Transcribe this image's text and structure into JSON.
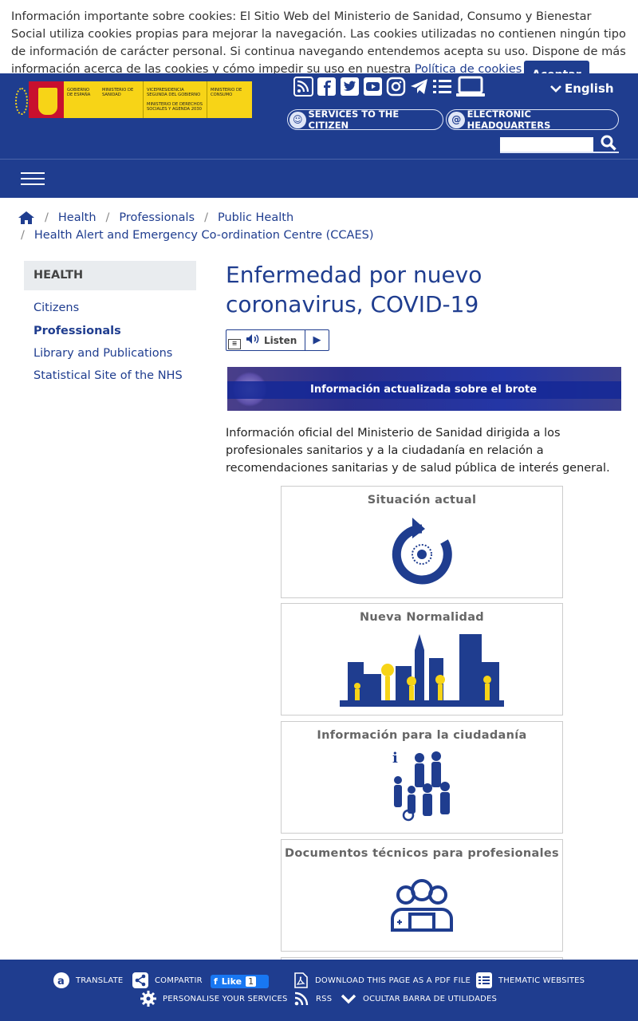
{
  "cookie": {
    "text": "Información importante sobre cookies: El Sitio Web del Ministerio de Sanidad, Consumo y Bienestar Social utiliza cookies propias para mejorar la navegación. Las cookies utilizadas no contienen ningún tipo de información de carácter personal. Si continua navegando entendemos acepta su uso. Dispone de más información acerca de las cookies y cómo impedir su uso en nuestra",
    "link": "Política de cookies",
    "accept": "Aceptar"
  },
  "header": {
    "logo": {
      "gov": "GOBIERNO DE ESPAÑA",
      "min1": "MINISTERIO DE SANIDAD",
      "vp": "VICEPRESIDENCIA SEGUNDA DEL GOBIERNO",
      "min2": "MINISTERIO DE DERECHOS SOCIALES Y AGENDA 2030",
      "min3": "MINISTERIO DE CONSUMO"
    },
    "language": "English",
    "services": "SERVICES TO THE CITIZEN",
    "headquarters": "ELECTRONIC HEADQUARTERS",
    "search": {
      "value": ""
    },
    "social_icons": [
      "rss-icon",
      "facebook-icon",
      "twitter-icon",
      "youtube-icon",
      "instagram-icon",
      "telegram-icon",
      "list-icon",
      "laptop-icon"
    ]
  },
  "breadcrumb": {
    "items": [
      "Health",
      "Professionals",
      "Public Health",
      "Health Alert and Emergency Co-ordination Centre (CCAES)"
    ]
  },
  "sidebar": {
    "heading": "HEALTH",
    "items": [
      "Citizens",
      "Professionals",
      "Library and Publications",
      "Statistical Site of the NHS"
    ]
  },
  "main": {
    "title": "Enfermedad por nuevo coronavirus, COVID-19",
    "listen": "Listen",
    "banner": "Información actualizada sobre el brote",
    "intro": "Información oficial del Ministerio de Sanidad dirigida a los profesionales sanitarios y a la ciudadanía en relación a recomendaciones sanitarias y de salud pública de interés general.",
    "cards": [
      "Situación actual",
      "Nueva Normalidad",
      "Información para la ciudadanía",
      "Documentos técnicos para profesionales"
    ]
  },
  "toolbar": {
    "translate": "TRANSLATE",
    "share": "COMPARTIR",
    "like": "Like",
    "like_count": "1",
    "pdf": "DOWNLOAD THIS PAGE AS A PDF FILE",
    "thematic": "THEMATIC WEBSITES",
    "personalise": "PERSONALISE YOUR SERVICES",
    "rss": "RSS",
    "hide": "OCULTAR BARRA DE UTILIDADES"
  },
  "colors": {
    "brand": "#1f3d8f",
    "accent": "#f7d417"
  }
}
